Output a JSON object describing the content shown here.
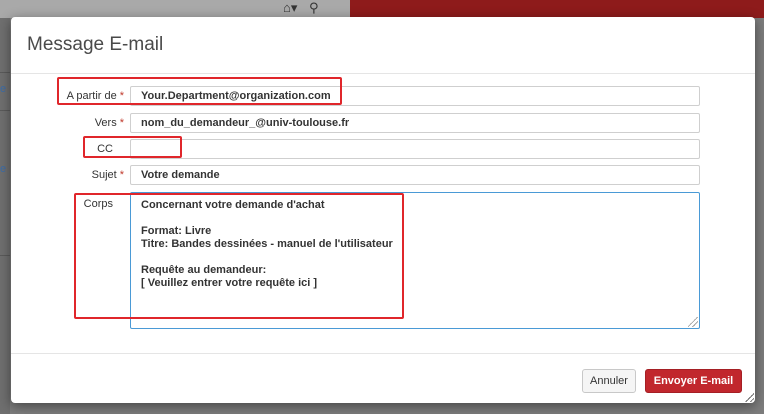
{
  "background": {
    "edge_marks": [
      "e",
      "e"
    ]
  },
  "modal": {
    "title": "Message E-mail",
    "required_marker": "*",
    "fields": {
      "from_label": "A partir de",
      "from_value": "Your.Department@organization.com",
      "to_label": "Vers",
      "to_value": "nom_du_demandeur_@univ-toulouse.fr",
      "cc_label": "CC",
      "cc_value": "",
      "subject_label": "Sujet",
      "subject_value": "Votre demande",
      "body_label": "Corps",
      "body_value": "Concernant votre demande d'achat\n\nFormat: Livre\nTitre: Bandes dessinées - manuel de l'utilisateur\n\nRequête au demandeur:\n[ Veuillez entrer votre requête ici ]"
    },
    "buttons": {
      "cancel_label": "Annuler",
      "send_label": "Envoyer E-mail"
    }
  },
  "colors": {
    "accent": "#c1272d",
    "highlight": "#e0262b",
    "textarea_focus": "#4a9ad6"
  },
  "icons": {
    "home": "home-icon",
    "search": "search-icon"
  }
}
